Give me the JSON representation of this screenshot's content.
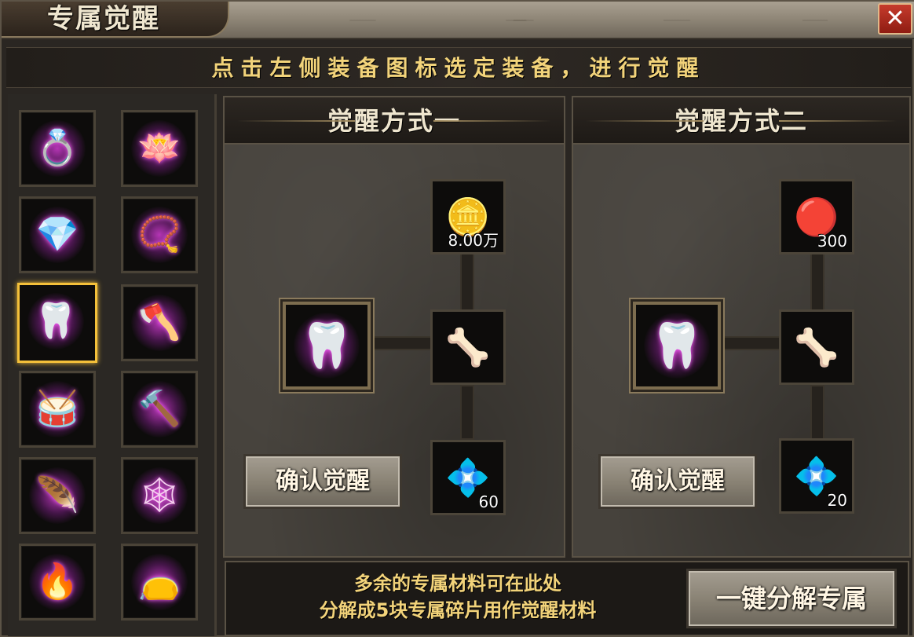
{
  "window": {
    "title": "专属觉醒",
    "close_label": "✕"
  },
  "instruction": "点击左侧装备图标选定装备，进行觉醒",
  "equipment_slots": [
    {
      "icon": "ring-icon",
      "glyph": "💍",
      "selected": false
    },
    {
      "icon": "lotus-icon",
      "glyph": "🪷",
      "selected": false
    },
    {
      "icon": "gem-cloth-icon",
      "glyph": "💎",
      "selected": false
    },
    {
      "icon": "necklace-icon",
      "glyph": "📿",
      "selected": false
    },
    {
      "icon": "tusk-icon",
      "glyph": "🦷",
      "selected": true
    },
    {
      "icon": "axe-icon",
      "glyph": "🪓",
      "selected": false
    },
    {
      "icon": "drum-icon",
      "glyph": "🥁",
      "selected": false
    },
    {
      "icon": "hammer-icon",
      "glyph": "🔨",
      "selected": false
    },
    {
      "icon": "feather-icon",
      "glyph": "🪶",
      "selected": false
    },
    {
      "icon": "web-icon",
      "glyph": "🕸",
      "selected": false
    },
    {
      "icon": "flame-orb-icon",
      "glyph": "🔥",
      "selected": false
    },
    {
      "icon": "pouch-icon",
      "glyph": "👝",
      "selected": false
    }
  ],
  "methods": [
    {
      "title": "觉醒方式一",
      "confirm_label": "确认觉醒",
      "top_material": {
        "icon": "gold-ingot-icon",
        "glyph": "🪙",
        "count": "8.00万"
      },
      "result": {
        "icon": "awakened-tusk-icon",
        "glyph": "🦴"
      },
      "bottom_material": {
        "icon": "crystal-icon",
        "glyph": "💠",
        "count": "60"
      },
      "source": {
        "icon": "tusk-icon",
        "glyph": "🦷"
      }
    },
    {
      "title": "觉醒方式二",
      "confirm_label": "确认觉醒",
      "top_material": {
        "icon": "red-gem-icon",
        "glyph": "🔴",
        "count": "300"
      },
      "result": {
        "icon": "awakened-tusk-icon",
        "glyph": "🦴"
      },
      "bottom_material": {
        "icon": "crystal-icon",
        "glyph": "💠",
        "count": "20"
      },
      "source": {
        "icon": "tusk-icon",
        "glyph": "🦷"
      }
    }
  ],
  "bottom": {
    "line1": "多余的专属材料可在此处",
    "line2": "分解成5块专属碎片用作觉醒材料",
    "decompose_label": "一键分解专属"
  }
}
